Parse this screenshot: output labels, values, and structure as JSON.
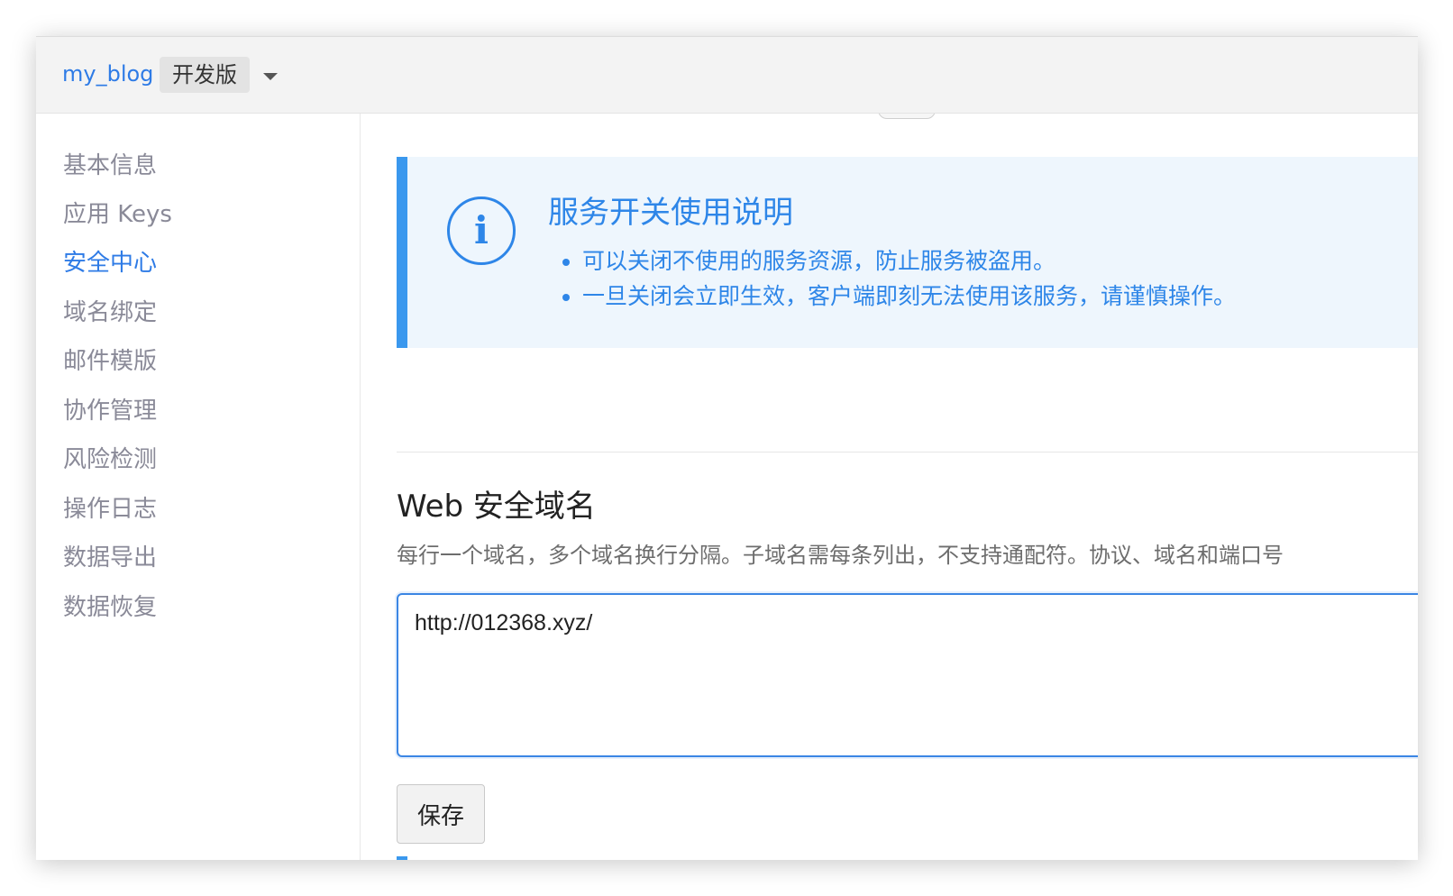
{
  "header": {
    "app_name": "my_blog",
    "edition": "开发版",
    "dropdown_icon": "caret-down-icon"
  },
  "sidebar": {
    "items": [
      {
        "label": "基本信息",
        "active": false
      },
      {
        "label": "应用 Keys",
        "active": false
      },
      {
        "label": "安全中心",
        "active": true
      },
      {
        "label": "域名绑定",
        "active": false
      },
      {
        "label": "邮件模版",
        "active": false
      },
      {
        "label": "协作管理",
        "active": false
      },
      {
        "label": "风险检测",
        "active": false
      },
      {
        "label": "操作日志",
        "active": false
      },
      {
        "label": "数据导出",
        "active": false
      },
      {
        "label": "数据恢复",
        "active": false
      }
    ]
  },
  "notice": {
    "icon": "info-circle-icon",
    "icon_glyph": "i",
    "title": "服务开关使用说明",
    "points": [
      "可以关闭不使用的服务资源，防止服务被盗用。",
      "一旦关闭会立即生效，客户端即刻无法使用该服务，请谨慎操作。"
    ]
  },
  "web_domains": {
    "title": "Web 安全域名",
    "description": "每行一个域名，多个域名换行分隔。子域名需每条列出，不支持通配符。协议、域名和端口号",
    "value": "http://012368.xyz/",
    "save_label": "保存"
  },
  "colors": {
    "accent": "#2e7be6",
    "notice_bg": "#eef6fd",
    "notice_border": "#3a98ee",
    "sidebar_text": "#8a8a98"
  }
}
